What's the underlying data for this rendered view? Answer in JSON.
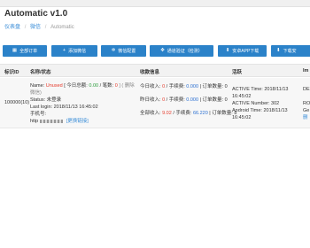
{
  "header": {
    "title": "Automatic v1.0",
    "breadcrumb": [
      "仪表盘",
      "微信",
      "Automatic"
    ]
  },
  "toolbar": {
    "buttons": [
      {
        "icon": "grid",
        "label": "全部订单"
      },
      {
        "icon": "plus",
        "label": "添加微信"
      },
      {
        "icon": "gear",
        "label": "微信配置"
      },
      {
        "icon": "move",
        "label": "通道验证（检测）"
      },
      {
        "icon": "download",
        "label": "安卓APP下载"
      },
      {
        "icon": "download",
        "label": "下载安"
      }
    ]
  },
  "table": {
    "headers": [
      "标识ID",
      "名称/状态",
      "收款信息",
      "活跃",
      "Im"
    ],
    "row": {
      "id": "100000(10)",
      "name_label": "Name:",
      "name_value": "Unused",
      "today_total_label": "[ 今日总额:",
      "today_total": "0.00",
      "count_label": "/ 笔数:",
      "count": "0",
      "delete_label": "] (",
      "delete_link": "删除",
      "delete_link_2": "微信",
      "delete_tail": ")",
      "status_label": "Status:",
      "status_value": "未登录",
      "last_login_label": "Last login:",
      "last_login": "2018/11/13 16:45:02",
      "phone_label": "手机号:",
      "url_prefix": "http",
      "change_link": "[更换链接]",
      "today_income_label": "今日收入:",
      "today_income": "0",
      "fee_label": "/ 手续费:",
      "today_fee": "0.000",
      "orders_label": "| 订单数量:",
      "today_orders": "0",
      "yesterday_income_label": "昨日收入:",
      "yesterday_income": "0",
      "yesterday_fee": "0.000",
      "yesterday_orders": "0",
      "all_income_label": "全部收入:",
      "all_income": "9.02",
      "all_fee": "66.220",
      "all_orders": "8",
      "active_time_label": "ACTIVE Time:",
      "active_time": "2018/11/13",
      "active_time_clock": "16:45:02",
      "active_number_label": "ACTIVE Number:",
      "active_number": "302",
      "android_time_label": "Android Time:",
      "android_time": "2018/11/13",
      "android_time_clock": "16:45:02",
      "im_line1": "DE",
      "im_line2": "RO",
      "im_line3": "Ge",
      "im_line4": "删"
    }
  },
  "colors": {
    "primary": "#2b82c9",
    "danger": "#e53a2b",
    "success": "#2b9c3d",
    "link": "#3b8ed8"
  }
}
